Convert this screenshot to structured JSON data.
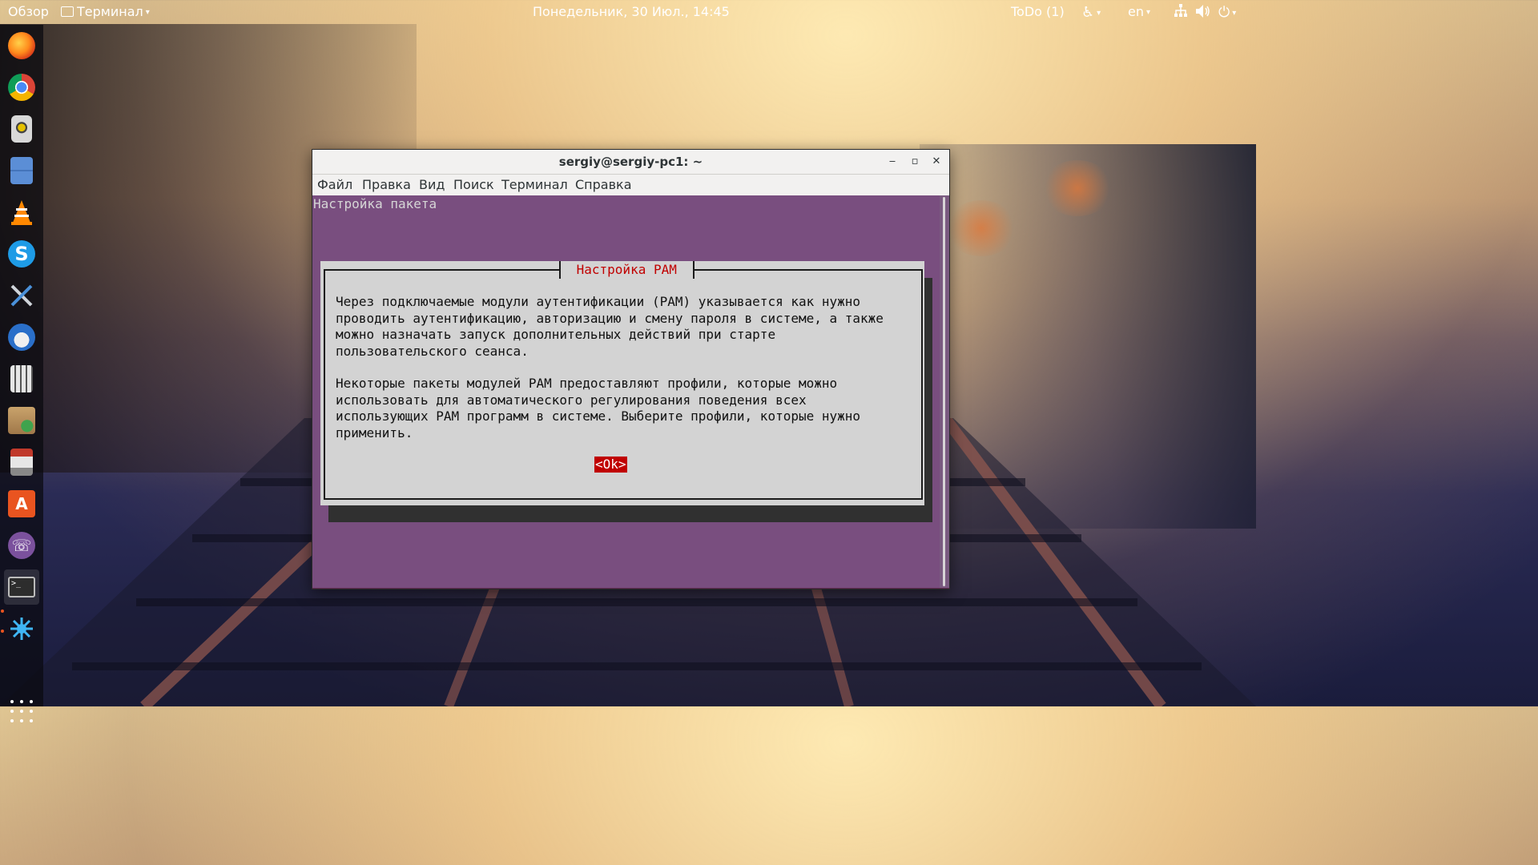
{
  "topbar": {
    "activities": "Обзор",
    "app_menu": "Терминал",
    "clock": "Понедельник, 30 Июл., 14:45",
    "todo": "ToDo (1)",
    "lang": "en"
  },
  "dock": {
    "items": [
      "firefox",
      "chrome",
      "rhythmbox",
      "files",
      "vlc",
      "skype",
      "tweak-tool",
      "thunderbird",
      "calculator",
      "archive-manager",
      "disk-installer",
      "software-center",
      "viber",
      "terminal",
      "wireshark"
    ]
  },
  "window": {
    "title": "sergiy@sergiy-pc1: ~",
    "menu": {
      "file": "Файл",
      "edit": "Правка",
      "view": "Вид",
      "search": "Поиск",
      "terminal": "Терминал",
      "help": "Справка"
    }
  },
  "terminal": {
    "header": "Настройка пакета",
    "dialog": {
      "title": " Настройка PAM ",
      "para1": "Через подключаемые модули аутентификации (PAM) указывается как нужно\nпроводить аутентификацию, авторизацию и смену пароля в системе, а также\nможно назначать запуск дополнительных действий при старте\nпользовательского сеанса.",
      "para2": "Некоторые пакеты модулей PAM предоставляют профили, которые можно\nиспользовать для автоматического регулирования поведения всех\nиспользующих PAM программ в системе. Выберите профили, которые нужно\nприменить.",
      "ok": "<Ok>"
    }
  },
  "colors": {
    "terminal_bg": "#794e7f",
    "dialog_bg": "#d3d3d3",
    "accent_red": "#c00000",
    "ubuntu_orange": "#e95420"
  }
}
